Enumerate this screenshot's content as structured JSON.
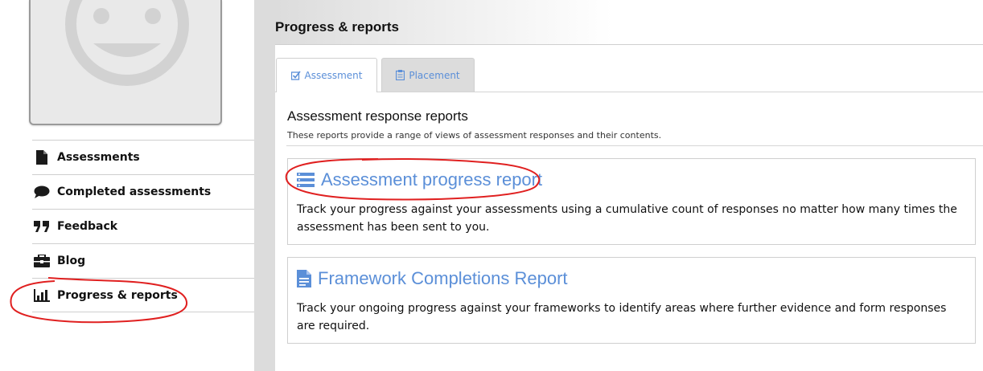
{
  "sidebar": {
    "items": [
      {
        "label": "Assessments",
        "icon": "file-icon"
      },
      {
        "label": "Completed assessments",
        "icon": "speech-bubble-icon"
      },
      {
        "label": "Feedback",
        "icon": "quote-icon"
      },
      {
        "label": "Blog",
        "icon": "briefcase-icon"
      },
      {
        "label": "Progress & reports",
        "icon": "bar-chart-icon"
      }
    ]
  },
  "header": {
    "title": "Progress & reports"
  },
  "tabs": [
    {
      "label": "Assessment",
      "icon": "checkbox-icon",
      "active": true
    },
    {
      "label": "Placement",
      "icon": "clipboard-icon",
      "active": false
    }
  ],
  "section": {
    "title": "Assessment response reports",
    "description": "These reports provide a range of views of assessment responses and their contents."
  },
  "reports": [
    {
      "title": "Assessment progress report",
      "icon": "list-icon",
      "description": "Track your progress against your assessments using a cumulative count of responses no matter how many times the assessment has been sent to you."
    },
    {
      "title": "Framework Completions Report",
      "icon": "document-icon",
      "description": "Track your ongoing progress against your frameworks to identify areas where further evidence and form responses are required."
    }
  ],
  "colors": {
    "link": "#5b8fd8",
    "annotation": "#e02020",
    "sidebar_bar": "#dcdcdc"
  }
}
